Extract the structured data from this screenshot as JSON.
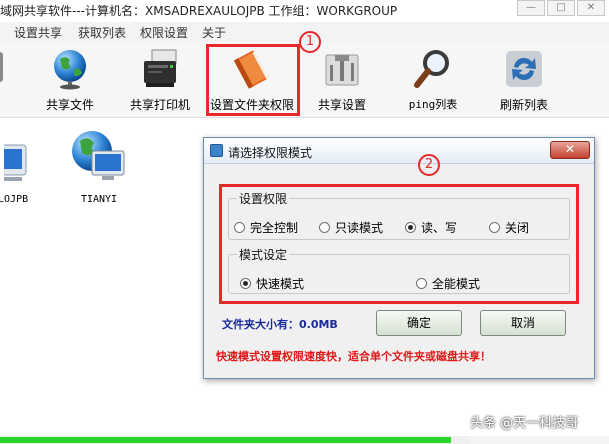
{
  "window": {
    "title": "域网共享软件---计算机名：XMSADREXAULOJPB 工作组：WORKGROUP",
    "minimize": "—",
    "maximize": "□",
    "close": "✕"
  },
  "menu": [
    "设置共享",
    "获取列表",
    "权限设置",
    "关于"
  ],
  "toolbar": {
    "items": [
      {
        "label": "共享文件",
        "icon": "globe-icon"
      },
      {
        "label": "共享打印机",
        "icon": "printer-icon"
      },
      {
        "label": "设置文件夹权限",
        "icon": "folder-book-icon"
      },
      {
        "label": "共享设置",
        "icon": "tools-icon"
      },
      {
        "label": "ping列表",
        "icon": "magnifier-icon"
      },
      {
        "label": "刷新列表",
        "icon": "refresh-icon"
      }
    ],
    "badge": "1"
  },
  "hosts": [
    {
      "label": "ULOJPB"
    },
    {
      "label": "TIANYI"
    }
  ],
  "dialog": {
    "title": "请选择权限模式",
    "badge": "2",
    "permission_group": {
      "legend": "设置权限",
      "options": [
        "完全控制",
        "只读模式",
        "读、写",
        "关闭"
      ],
      "selected": "读、写"
    },
    "mode_group": {
      "legend": "模式设定",
      "options": [
        "快速模式",
        "全能模式"
      ],
      "selected": "快速模式"
    },
    "size_text": "文件夹大小有：0.0MB",
    "ok_label": "确定",
    "cancel_label": "取消",
    "warning": "快速模式设置权限速度快，适合单个文件夹或磁盘共享！"
  },
  "watermark": "头条 @天一科技哥",
  "progress": 0.74,
  "colors": {
    "highlight": "#e8282b",
    "progress": "#2bd42b",
    "warning": "#e01818",
    "size_text": "#1a2a9a"
  }
}
